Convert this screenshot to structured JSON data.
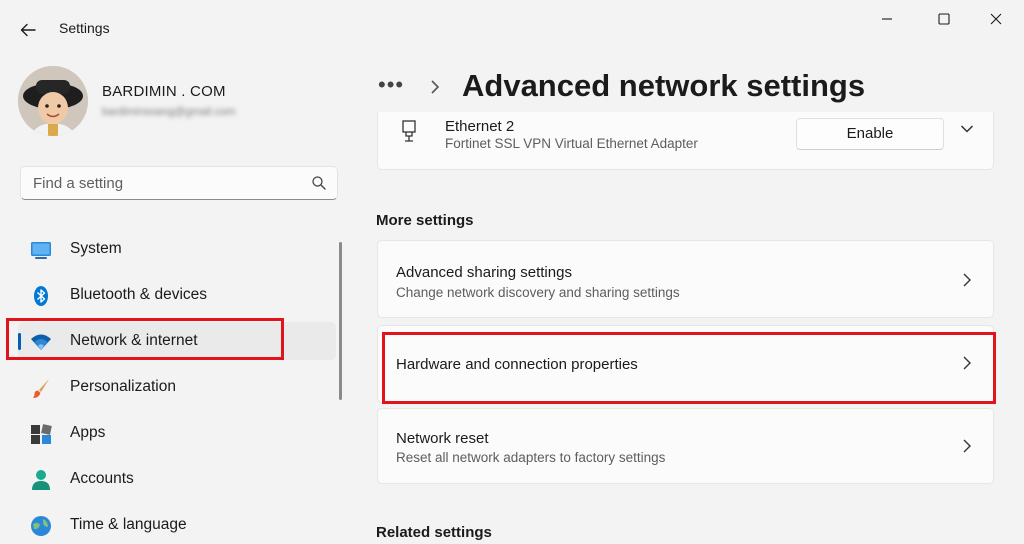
{
  "window": {
    "app_title": "Settings",
    "icons": {
      "back": "back-arrow-icon",
      "minimize": "minimize-icon",
      "maximize": "maximize-icon",
      "close": "close-icon"
    }
  },
  "profile": {
    "name": "BARDIMIN . COM",
    "email": "bardiminsoang@gmail.com"
  },
  "search": {
    "placeholder": "Find a setting",
    "icon": "search-icon"
  },
  "sidebar": {
    "items": [
      {
        "label": "System",
        "icon": "system-icon",
        "selected": false
      },
      {
        "label": "Bluetooth & devices",
        "icon": "bluetooth-icon",
        "selected": false
      },
      {
        "label": "Network & internet",
        "icon": "wifi-icon",
        "selected": true
      },
      {
        "label": "Personalization",
        "icon": "paintbrush-icon",
        "selected": false
      },
      {
        "label": "Apps",
        "icon": "apps-icon",
        "selected": false
      },
      {
        "label": "Accounts",
        "icon": "accounts-icon",
        "selected": false
      },
      {
        "label": "Time & language",
        "icon": "globe-icon",
        "selected": false
      }
    ]
  },
  "header": {
    "breadcrumb_overflow": "•••",
    "title": "Advanced network settings"
  },
  "ethernet": {
    "name": "Ethernet 2",
    "description": "Fortinet SSL VPN Virtual Ethernet Adapter",
    "button_label": "Enable",
    "icon": "ethernet-icon"
  },
  "more_settings": {
    "heading": "More settings",
    "items": [
      {
        "title": "Advanced sharing settings",
        "subtitle": "Change network discovery and sharing settings"
      },
      {
        "title": "Hardware and connection properties",
        "subtitle": ""
      },
      {
        "title": "Network reset",
        "subtitle": "Reset all network adapters to factory settings"
      }
    ]
  },
  "related_settings": {
    "heading": "Related settings"
  },
  "colors": {
    "accent": "#005fb8",
    "highlight": "#e1141b",
    "background": "#f3f3f3",
    "card": "#fbfbfb"
  }
}
